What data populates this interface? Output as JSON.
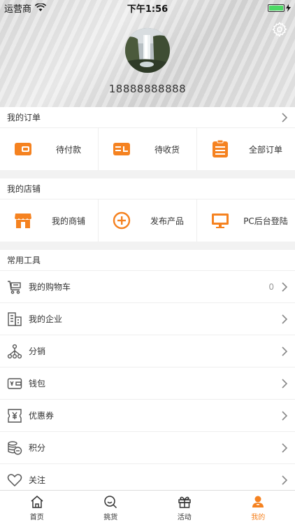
{
  "status": {
    "carrier": "运营商",
    "time": "下午1:56"
  },
  "profile": {
    "phone": "18888888888"
  },
  "orders": {
    "title": "我的订单",
    "items": [
      {
        "label": "待付款",
        "icon": "wallet-icon"
      },
      {
        "label": "待收货",
        "icon": "delivery-card-icon"
      },
      {
        "label": "全部订单",
        "icon": "clipboard-icon"
      }
    ]
  },
  "shop": {
    "title": "我的店铺",
    "items": [
      {
        "label": "我的商铺",
        "icon": "storefront-icon"
      },
      {
        "label": "发布产品",
        "icon": "plus-circle-icon"
      },
      {
        "label": "PC后台登陆",
        "icon": "monitor-icon"
      }
    ]
  },
  "tools": {
    "title": "常用工具",
    "items": [
      {
        "label": "我的购物车",
        "count": "0",
        "icon": "cart-icon"
      },
      {
        "label": "我的企业",
        "icon": "building-icon"
      },
      {
        "label": "分销",
        "icon": "share-nodes-icon"
      },
      {
        "label": "钱包",
        "icon": "wallet-outline-icon"
      },
      {
        "label": "优惠券",
        "icon": "coupon-icon"
      },
      {
        "label": "积分",
        "icon": "coins-icon"
      },
      {
        "label": "关注",
        "icon": "heart-icon"
      }
    ]
  },
  "tabbar": {
    "items": [
      {
        "label": "首页",
        "icon": "home-icon"
      },
      {
        "label": "挑货",
        "icon": "search-goods-icon"
      },
      {
        "label": "活动",
        "icon": "gift-icon"
      },
      {
        "label": "我的",
        "icon": "user-icon",
        "active": true
      }
    ]
  },
  "colors": {
    "accent": "#f58220",
    "icon_gray": "#555555"
  }
}
